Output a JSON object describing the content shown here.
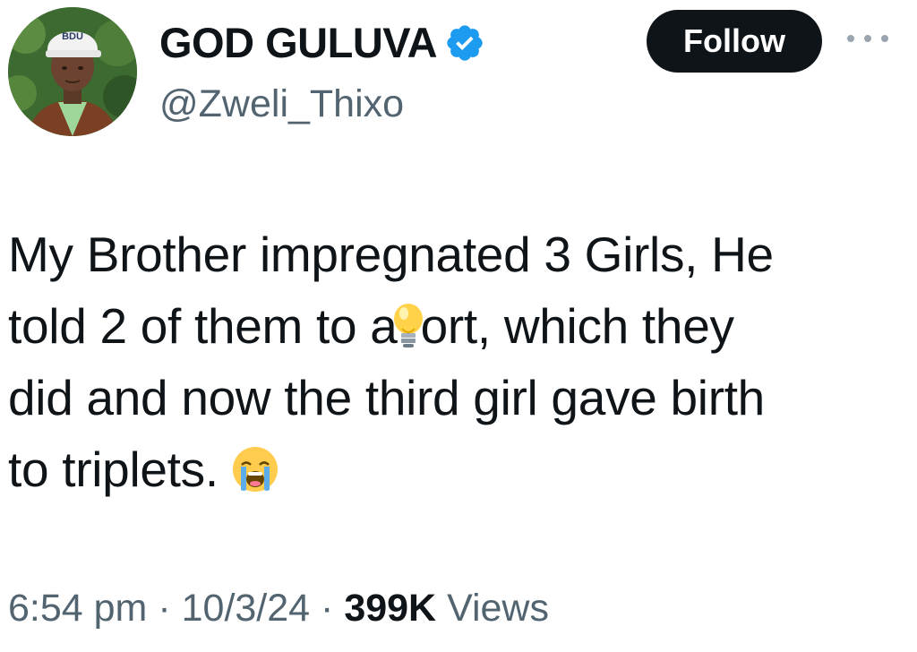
{
  "author": {
    "display_name": "GOD GULUVA",
    "handle": "@Zweli_Thixo",
    "verified": true,
    "avatar_cap_text": "BDU"
  },
  "actions": {
    "follow_label": "Follow",
    "more_icon": "more-horizontal-icon"
  },
  "tweet": {
    "lines": [
      {
        "before": "My Brother impregnated 3 Girls, He"
      },
      {
        "before": "told 2 of them to a",
        "emoji": "light-bulb-icon",
        "after": "ort, which they"
      },
      {
        "before": "did and now the third girl gave birth"
      },
      {
        "before": "to triplets.",
        "emoji": "loudly-crying-face-icon"
      }
    ]
  },
  "meta": {
    "time": "6:54 pm",
    "separator": "·",
    "date": "10/3/24",
    "views_count": "399K",
    "views_label": "Views"
  },
  "colors": {
    "text": "#0f1419",
    "secondary": "#536471",
    "follow_bg": "#0f1419",
    "verified_blue": "#1d9bf0"
  }
}
